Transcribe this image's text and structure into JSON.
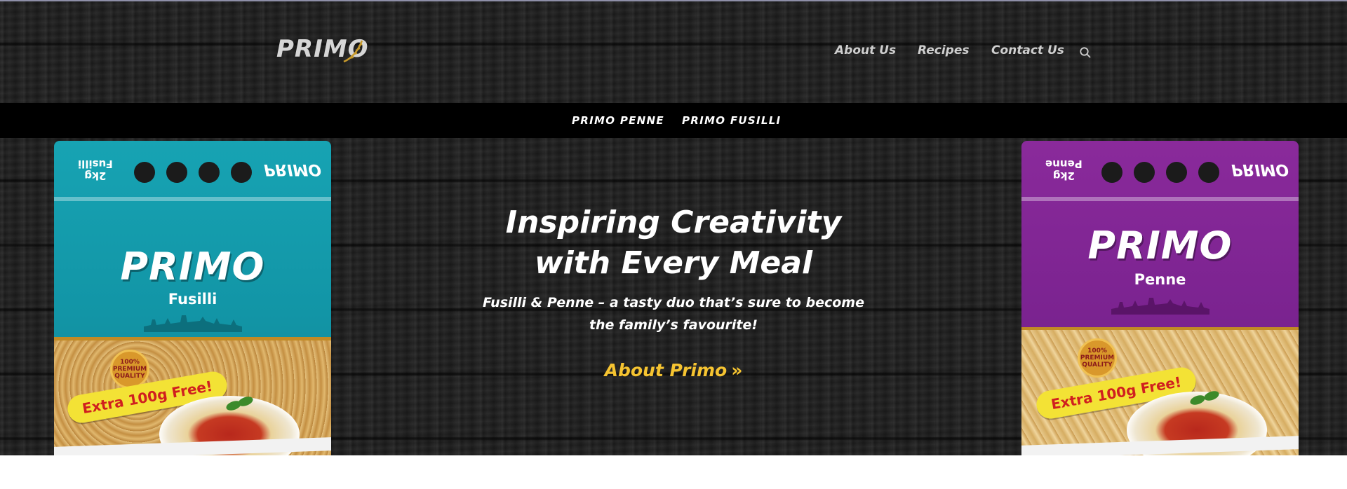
{
  "header": {
    "logo_text": "PRIMO",
    "nav": [
      {
        "label": "About Us"
      },
      {
        "label": "Recipes"
      },
      {
        "label": "Contact Us"
      }
    ],
    "search_icon": "search-icon"
  },
  "subnav": [
    {
      "label": "PRIMO PENNE"
    },
    {
      "label": "PRIMO FUSILLI"
    }
  ],
  "hero": {
    "title_line1": "Inspiring Creativity",
    "title_line2": "with Every Meal",
    "subtitle_line1": "Fusilli & Penne – a tasty duo that’s sure to become",
    "subtitle_line2": "the family’s favourite!",
    "cta_label": "About Primo",
    "cta_icon": "double-chevron-right-icon"
  },
  "bags": {
    "left": {
      "brand": "PRIMO",
      "variant": "Fusilli",
      "top_brand": "PRIMO",
      "top_weight_line1": "Fusilli",
      "top_weight_line2": "2kg",
      "seal_line1": "100%",
      "seal_line2": "PREMIUM",
      "seal_line3": "QUALITY",
      "ribbon": "Extra 100g Free!"
    },
    "right": {
      "brand": "PRIMO",
      "variant": "Penne",
      "top_brand": "PRIMO",
      "top_weight_line1": "Penne",
      "top_weight_line2": "2kg",
      "seal_line1": "100%",
      "seal_line2": "PREMIUM",
      "seal_line3": "QUALITY",
      "ribbon": "Extra 100g Free!"
    }
  },
  "colors": {
    "accent": "#f6c431",
    "fusilli_bag": "#17a3b3",
    "penne_bag": "#8a2a9b",
    "subnav_bg": "#000000"
  }
}
